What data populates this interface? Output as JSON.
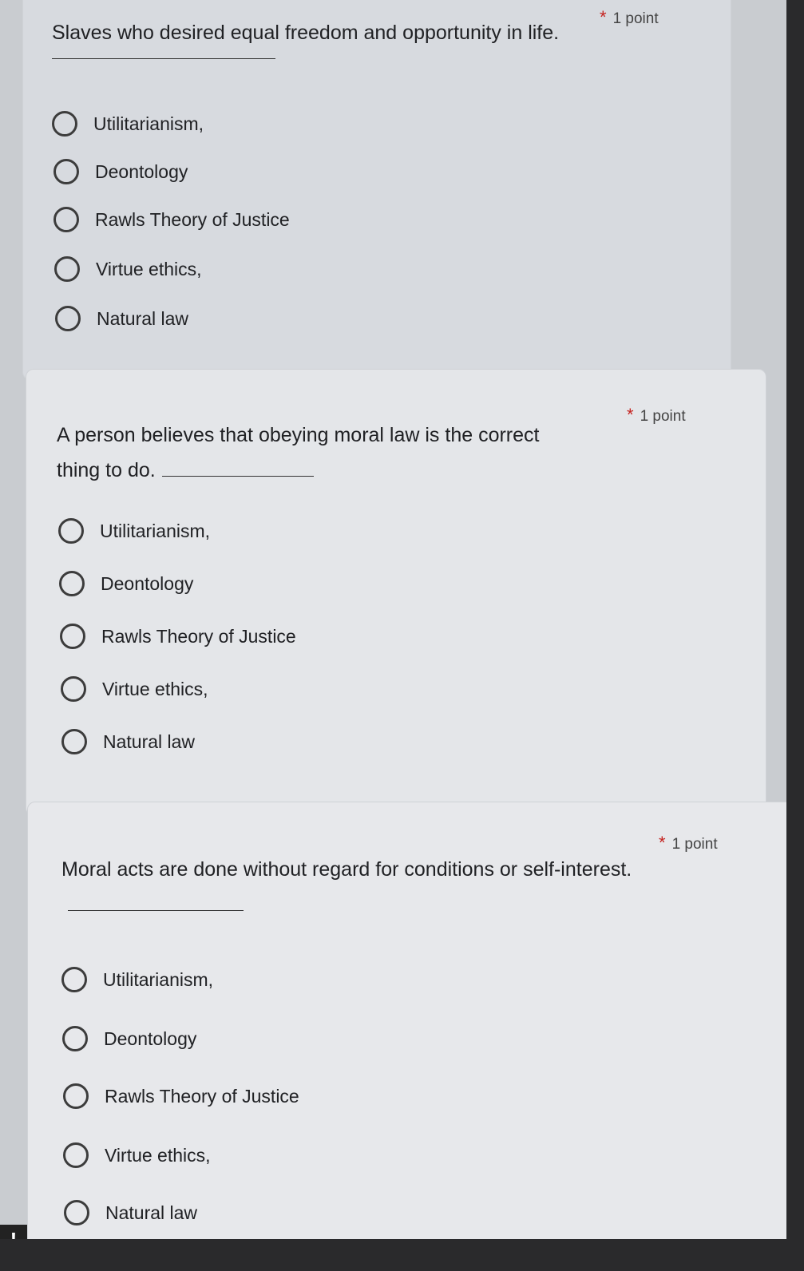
{
  "questions": [
    {
      "text": "Slaves who desired equal freedom and opportunity in life.",
      "required_marker": "*",
      "points": "1 point",
      "options": [
        "Utilitarianism,",
        "Deontology",
        "Rawls Theory of Justice",
        "Virtue ethics,",
        "Natural law"
      ]
    },
    {
      "text": "A person believes that obeying moral law is the correct thing to do.",
      "required_marker": "*",
      "points": "1 point",
      "options": [
        "Utilitarianism,",
        "Deontology",
        "Rawls Theory of Justice",
        "Virtue ethics,",
        "Natural law"
      ]
    },
    {
      "text": "Moral acts are done without regard for conditions or self-interest.",
      "required_marker": "*",
      "points": "1 point",
      "options": [
        "Utilitarianism,",
        "Deontology",
        "Rawls Theory of Justice",
        "Virtue ethics,",
        "Natural law"
      ]
    }
  ],
  "alert": {
    "symbol": "!"
  }
}
